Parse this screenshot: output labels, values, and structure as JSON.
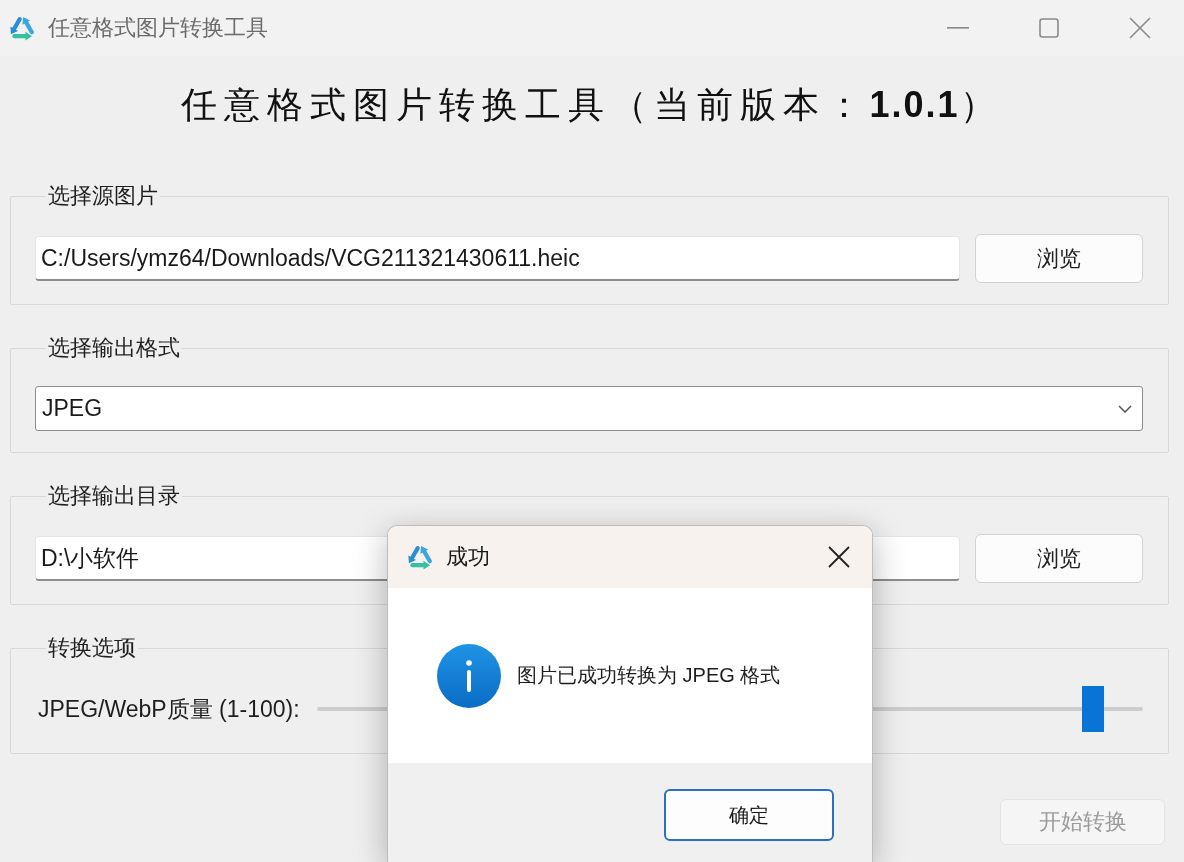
{
  "window": {
    "title": "任意格式图片转换工具"
  },
  "heading": "任意格式图片转换工具（当前版本：**1.0.1**）",
  "groups": [
    {
      "kind": "file",
      "title": "选择源图片",
      "value": "C:/Users/ymz64/Downloads/VCG211321430611.heic",
      "button": "浏览"
    },
    {
      "kind": "select",
      "title": "选择输出格式",
      "value": "JPEG"
    },
    {
      "kind": "file",
      "title": "选择输出目录",
      "value": "D:\\小软件",
      "button": "浏览"
    },
    {
      "kind": "slider",
      "title": "转换选项",
      "label": "JPEG/WebP质量 (1-100):",
      "level": 0.94
    }
  ],
  "start_button": {
    "label": "开始转换",
    "disabled": true
  },
  "dialog": {
    "title": "成功",
    "message": "图片已成功转换为 JPEG 格式",
    "button": {
      "label": "确定",
      "focused": true
    }
  }
}
